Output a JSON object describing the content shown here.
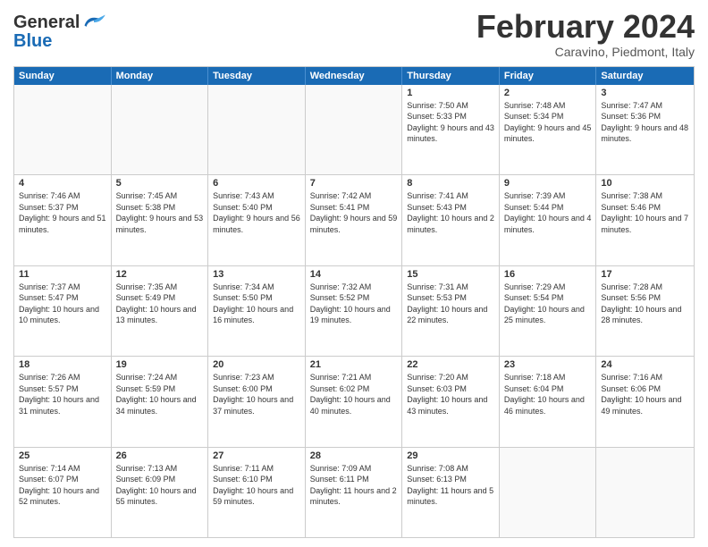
{
  "logo": {
    "text_general": "General",
    "text_blue": "Blue"
  },
  "header": {
    "month": "February 2024",
    "location": "Caravino, Piedmont, Italy"
  },
  "weekdays": [
    "Sunday",
    "Monday",
    "Tuesday",
    "Wednesday",
    "Thursday",
    "Friday",
    "Saturday"
  ],
  "weeks": [
    [
      {
        "day": "",
        "info": ""
      },
      {
        "day": "",
        "info": ""
      },
      {
        "day": "",
        "info": ""
      },
      {
        "day": "",
        "info": ""
      },
      {
        "day": "1",
        "info": "Sunrise: 7:50 AM\nSunset: 5:33 PM\nDaylight: 9 hours and 43 minutes."
      },
      {
        "day": "2",
        "info": "Sunrise: 7:48 AM\nSunset: 5:34 PM\nDaylight: 9 hours and 45 minutes."
      },
      {
        "day": "3",
        "info": "Sunrise: 7:47 AM\nSunset: 5:36 PM\nDaylight: 9 hours and 48 minutes."
      }
    ],
    [
      {
        "day": "4",
        "info": "Sunrise: 7:46 AM\nSunset: 5:37 PM\nDaylight: 9 hours and 51 minutes."
      },
      {
        "day": "5",
        "info": "Sunrise: 7:45 AM\nSunset: 5:38 PM\nDaylight: 9 hours and 53 minutes."
      },
      {
        "day": "6",
        "info": "Sunrise: 7:43 AM\nSunset: 5:40 PM\nDaylight: 9 hours and 56 minutes."
      },
      {
        "day": "7",
        "info": "Sunrise: 7:42 AM\nSunset: 5:41 PM\nDaylight: 9 hours and 59 minutes."
      },
      {
        "day": "8",
        "info": "Sunrise: 7:41 AM\nSunset: 5:43 PM\nDaylight: 10 hours and 2 minutes."
      },
      {
        "day": "9",
        "info": "Sunrise: 7:39 AM\nSunset: 5:44 PM\nDaylight: 10 hours and 4 minutes."
      },
      {
        "day": "10",
        "info": "Sunrise: 7:38 AM\nSunset: 5:46 PM\nDaylight: 10 hours and 7 minutes."
      }
    ],
    [
      {
        "day": "11",
        "info": "Sunrise: 7:37 AM\nSunset: 5:47 PM\nDaylight: 10 hours and 10 minutes."
      },
      {
        "day": "12",
        "info": "Sunrise: 7:35 AM\nSunset: 5:49 PM\nDaylight: 10 hours and 13 minutes."
      },
      {
        "day": "13",
        "info": "Sunrise: 7:34 AM\nSunset: 5:50 PM\nDaylight: 10 hours and 16 minutes."
      },
      {
        "day": "14",
        "info": "Sunrise: 7:32 AM\nSunset: 5:52 PM\nDaylight: 10 hours and 19 minutes."
      },
      {
        "day": "15",
        "info": "Sunrise: 7:31 AM\nSunset: 5:53 PM\nDaylight: 10 hours and 22 minutes."
      },
      {
        "day": "16",
        "info": "Sunrise: 7:29 AM\nSunset: 5:54 PM\nDaylight: 10 hours and 25 minutes."
      },
      {
        "day": "17",
        "info": "Sunrise: 7:28 AM\nSunset: 5:56 PM\nDaylight: 10 hours and 28 minutes."
      }
    ],
    [
      {
        "day": "18",
        "info": "Sunrise: 7:26 AM\nSunset: 5:57 PM\nDaylight: 10 hours and 31 minutes."
      },
      {
        "day": "19",
        "info": "Sunrise: 7:24 AM\nSunset: 5:59 PM\nDaylight: 10 hours and 34 minutes."
      },
      {
        "day": "20",
        "info": "Sunrise: 7:23 AM\nSunset: 6:00 PM\nDaylight: 10 hours and 37 minutes."
      },
      {
        "day": "21",
        "info": "Sunrise: 7:21 AM\nSunset: 6:02 PM\nDaylight: 10 hours and 40 minutes."
      },
      {
        "day": "22",
        "info": "Sunrise: 7:20 AM\nSunset: 6:03 PM\nDaylight: 10 hours and 43 minutes."
      },
      {
        "day": "23",
        "info": "Sunrise: 7:18 AM\nSunset: 6:04 PM\nDaylight: 10 hours and 46 minutes."
      },
      {
        "day": "24",
        "info": "Sunrise: 7:16 AM\nSunset: 6:06 PM\nDaylight: 10 hours and 49 minutes."
      }
    ],
    [
      {
        "day": "25",
        "info": "Sunrise: 7:14 AM\nSunset: 6:07 PM\nDaylight: 10 hours and 52 minutes."
      },
      {
        "day": "26",
        "info": "Sunrise: 7:13 AM\nSunset: 6:09 PM\nDaylight: 10 hours and 55 minutes."
      },
      {
        "day": "27",
        "info": "Sunrise: 7:11 AM\nSunset: 6:10 PM\nDaylight: 10 hours and 59 minutes."
      },
      {
        "day": "28",
        "info": "Sunrise: 7:09 AM\nSunset: 6:11 PM\nDaylight: 11 hours and 2 minutes."
      },
      {
        "day": "29",
        "info": "Sunrise: 7:08 AM\nSunset: 6:13 PM\nDaylight: 11 hours and 5 minutes."
      },
      {
        "day": "",
        "info": ""
      },
      {
        "day": "",
        "info": ""
      }
    ]
  ]
}
